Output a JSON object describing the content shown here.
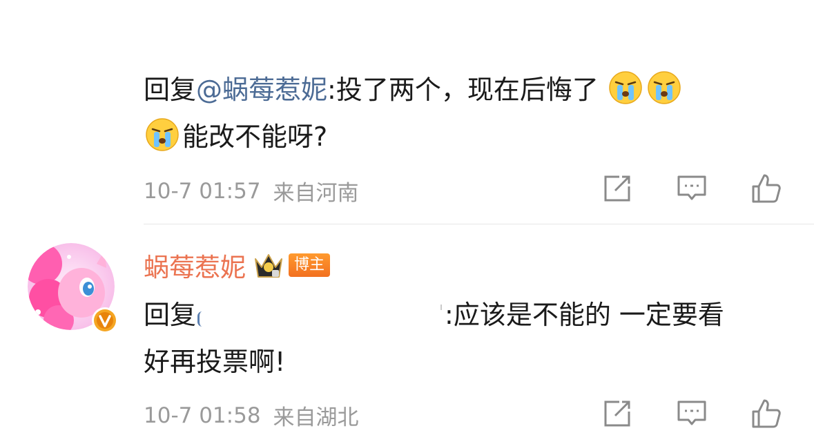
{
  "comment1": {
    "reply_prefix": "回复",
    "mention": "@蜗莓惹妮",
    "text_a": ":投了两个，现在后悔了",
    "text_b": "能改不能呀?",
    "emoji": "crying-face-icon",
    "time": "10-7 01:57",
    "location": "来自河南"
  },
  "comment2": {
    "username": "蜗莓惹妮",
    "author_badge": "博主",
    "reply_prefix": "回复",
    "text_a": ":应该是不能的 一定要看",
    "text_b": "好再投票啊!",
    "time": "10-7 01:58",
    "location": "来自湖北"
  },
  "colors": {
    "mention": "#4c6b95",
    "username": "#eb7350",
    "meta": "#9a9a9a"
  },
  "icons": [
    "share-icon",
    "comment-icon",
    "like-icon",
    "crown-icon",
    "verified-v-icon"
  ]
}
